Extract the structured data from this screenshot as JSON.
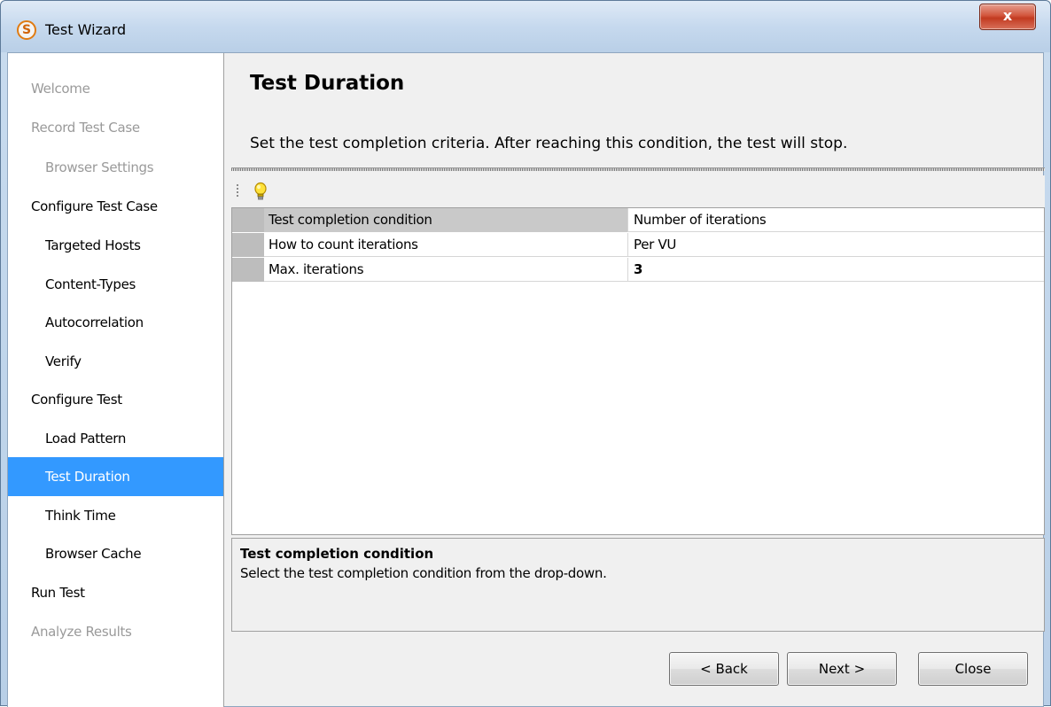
{
  "window": {
    "title": "Test Wizard",
    "app_icon_letter": "S",
    "close_glyph": "x"
  },
  "sidebar": {
    "items": [
      {
        "label": "Welcome",
        "level": 0,
        "state": "disabled"
      },
      {
        "label": "Record Test Case",
        "level": 0,
        "state": "disabled"
      },
      {
        "label": "Browser Settings",
        "level": 1,
        "state": "disabled"
      },
      {
        "label": "Configure Test Case",
        "level": 0,
        "state": "enabled"
      },
      {
        "label": "Targeted Hosts",
        "level": 1,
        "state": "enabled"
      },
      {
        "label": "Content-Types",
        "level": 1,
        "state": "enabled"
      },
      {
        "label": "Autocorrelation",
        "level": 1,
        "state": "enabled"
      },
      {
        "label": "Verify",
        "level": 1,
        "state": "enabled"
      },
      {
        "label": "Configure Test",
        "level": 0,
        "state": "enabled"
      },
      {
        "label": "Load Pattern",
        "level": 1,
        "state": "enabled"
      },
      {
        "label": "Test Duration",
        "level": 1,
        "state": "selected"
      },
      {
        "label": "Think Time",
        "level": 1,
        "state": "enabled"
      },
      {
        "label": "Browser Cache",
        "level": 1,
        "state": "enabled"
      },
      {
        "label": "Run Test",
        "level": 0,
        "state": "enabled"
      },
      {
        "label": "Analyze Results",
        "level": 0,
        "state": "disabled"
      }
    ]
  },
  "main": {
    "title": "Test Duration",
    "subtitle": "Set the test completion criteria. After reaching this condition, the test will stop.",
    "toolbar": {
      "hint_icon": "lightbulb-icon"
    },
    "properties": [
      {
        "name": "Test completion condition",
        "value": "Number of iterations",
        "bold": false,
        "selected": true
      },
      {
        "name": "How to count iterations",
        "value": "Per VU",
        "bold": false,
        "selected": false
      },
      {
        "name": "Max. iterations",
        "value": "3",
        "bold": true,
        "selected": false
      }
    ],
    "description": {
      "title": "Test completion condition",
      "text": "Select the test completion condition from the drop-down."
    }
  },
  "buttons": {
    "back": "< Back",
    "next": "Next >",
    "close": "Close"
  },
  "colors": {
    "selection": "#3399ff",
    "disabled_text": "#9a9a9a",
    "gutter": "#bdbdbd"
  }
}
